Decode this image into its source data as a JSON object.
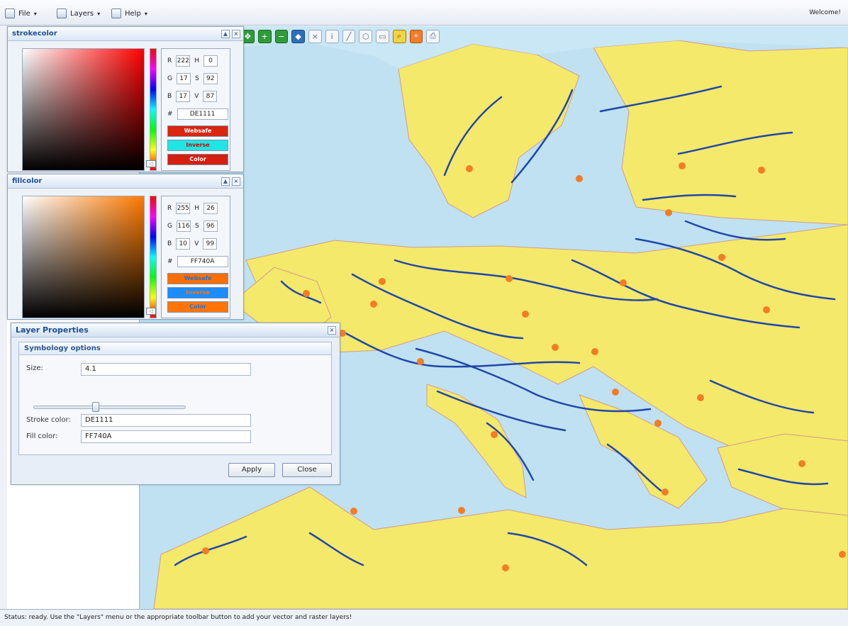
{
  "menu": {
    "file": "File",
    "layers": "Layers",
    "help": "Help",
    "welcome": "Welcome!"
  },
  "strokecolor": {
    "title": "strokecolor",
    "R": "222",
    "G": "17",
    "B": "17",
    "H": "0",
    "S": "92",
    "V": "87",
    "hex": "DE1111",
    "websafe": "Websafe",
    "inverse": "Inverse",
    "color": "Color",
    "swatches": [
      "#d9260f",
      "#21e5e5",
      "#d61f0f"
    ]
  },
  "fillcolor": {
    "title": "fillcolor",
    "R": "255",
    "G": "116",
    "B": "10",
    "H": "26",
    "S": "96",
    "V": "99",
    "hex": "FF740A",
    "websafe": "Websafe",
    "inverse": "Inverse",
    "color": "Color",
    "swatches": [
      "#ff6e00",
      "#1d8cff",
      "#ff750a"
    ]
  },
  "layer_properties": {
    "title": "Layer Properties",
    "section_title": "Symbology options",
    "size_label": "Size:",
    "size_value": "4.1",
    "size_fraction": 0.46,
    "stroke_label": "Stroke color:",
    "stroke_value": "DE1111",
    "fill_label": "Fill color:",
    "fill_value": "FF740A",
    "apply": "Apply",
    "close": "Close"
  },
  "status": {
    "text": "Status: ready. Use the \"Layers\" menu or the appropriate toolbar button to add your vector and raster layers!"
  },
  "icons": {
    "toolbar": [
      "pan-icon",
      "zoom-in-layer-icon",
      "zoom-out-layer-icon",
      "add-layer-icon",
      "delete-layer-icon",
      "layer-info-icon",
      "draw-line-icon",
      "draw-polygon-icon",
      "draw-box-icon",
      "zoom-in-icon",
      "zoom-out-icon",
      "print-icon"
    ]
  },
  "colors": {
    "accent": "#1d4f96",
    "map_water": "#bfe1f1",
    "map_land": "#f4e96b",
    "river": "#2147a8",
    "border": "#d98f9e",
    "city": "#f47c25"
  }
}
